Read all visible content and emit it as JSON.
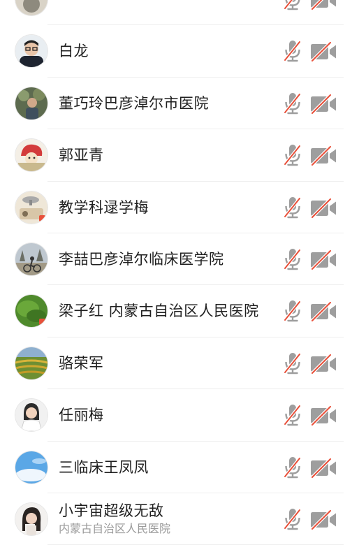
{
  "participants": [
    {
      "name": "",
      "subtitle": "",
      "mic": "muted",
      "camera": "off",
      "avatar": "partial"
    },
    {
      "name": "白龙",
      "subtitle": "",
      "mic": "muted",
      "camera": "off",
      "avatar": "man-glasses"
    },
    {
      "name": "董巧玲巴彦淖尔市医院",
      "subtitle": "",
      "mic": "muted",
      "camera": "off",
      "avatar": "person-outdoor"
    },
    {
      "name": "郭亚青",
      "subtitle": "",
      "mic": "muted",
      "camera": "off",
      "avatar": "cartoon"
    },
    {
      "name": "教学科逯学梅",
      "subtitle": "",
      "mic": "muted",
      "camera": "off",
      "avatar": "sketch"
    },
    {
      "name": "李喆巴彦淖尔临床医学院",
      "subtitle": "",
      "mic": "muted",
      "camera": "off",
      "avatar": "cyclist"
    },
    {
      "name": "梁子红 内蒙古自治区人民医院",
      "subtitle": "",
      "mic": "muted",
      "camera": "off",
      "avatar": "green-field"
    },
    {
      "name": "骆荣军",
      "subtitle": "",
      "mic": "muted",
      "camera": "off",
      "avatar": "terraces"
    },
    {
      "name": "任丽梅",
      "subtitle": "",
      "mic": "muted",
      "camera": "off",
      "avatar": "doctor"
    },
    {
      "name": "三临床王凤凤",
      "subtitle": "",
      "mic": "muted",
      "camera": "off",
      "avatar": "sky"
    },
    {
      "name": "小宇宙超级无敌",
      "subtitle": "内蒙古自治区人民医院",
      "mic": "muted",
      "camera": "off",
      "avatar": "woman"
    }
  ],
  "colors": {
    "icon_gray": "#9e9e9e",
    "slash_red": "#e8503a",
    "divider": "#eeeeee",
    "name_text": "#1f1f1f",
    "sub_text": "#9a9a9a"
  }
}
